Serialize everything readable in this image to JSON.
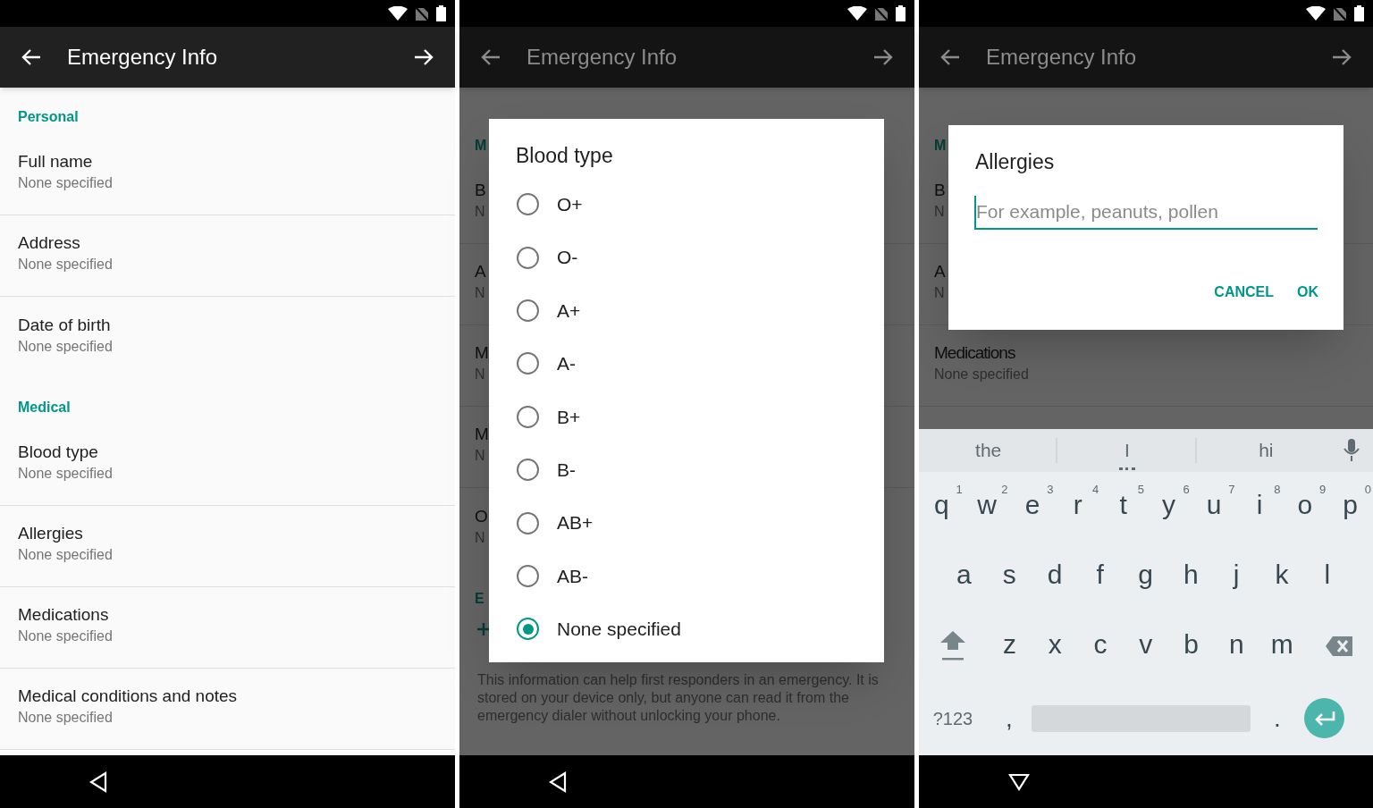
{
  "screens": [
    {
      "kind": "list",
      "dimmed": false,
      "toolbar": {
        "title": "Emergency Info"
      },
      "rows": [
        {
          "kind": "header",
          "text": "Personal"
        },
        {
          "kind": "item",
          "title": "Full name",
          "value": "None specified",
          "divider": true
        },
        {
          "kind": "item",
          "title": "Address",
          "value": "None specified",
          "divider": true
        },
        {
          "kind": "item",
          "title": "Date of birth",
          "value": "None specified",
          "divider": false
        },
        {
          "kind": "header",
          "text": "Medical"
        },
        {
          "kind": "item",
          "title": "Blood type",
          "value": "None specified",
          "divider": true
        },
        {
          "kind": "item",
          "title": "Allergies",
          "value": "None specified",
          "divider": true
        },
        {
          "kind": "item",
          "title": "Medications",
          "value": "None specified",
          "divider": true
        },
        {
          "kind": "item",
          "title": "Medical conditions and notes",
          "value": "None specified",
          "divider": true
        }
      ]
    },
    {
      "kind": "radio-dialog",
      "dimmed": true,
      "toolbar": {
        "title": "Emergency Info"
      },
      "rows": [
        {
          "kind": "header",
          "text": "M"
        },
        {
          "kind": "item",
          "title": "B",
          "value": "N",
          "divider": true
        },
        {
          "kind": "item",
          "title": "A",
          "value": "N",
          "divider": true
        },
        {
          "kind": "item",
          "title": "M",
          "value": "N",
          "divider": true
        },
        {
          "kind": "item",
          "title": "M",
          "value": "N",
          "divider": true
        },
        {
          "kind": "item",
          "title": "O",
          "value": "N",
          "divider": false
        },
        {
          "kind": "header",
          "text": "E"
        },
        {
          "kind": "add"
        }
      ],
      "footer": "This information can help first responders in an emergency. It is stored on your device only, but anyone can read it from the emergency dialer without unlocking your phone.",
      "dialog": {
        "title": "Blood type",
        "options": [
          {
            "label": "O+",
            "selected": false
          },
          {
            "label": "O-",
            "selected": false
          },
          {
            "label": "A+",
            "selected": false
          },
          {
            "label": "A-",
            "selected": false
          },
          {
            "label": "B+",
            "selected": false
          },
          {
            "label": "B-",
            "selected": false
          },
          {
            "label": "AB+",
            "selected": false
          },
          {
            "label": "AB-",
            "selected": false
          },
          {
            "label": "None specified",
            "selected": true
          }
        ]
      }
    },
    {
      "kind": "input-dialog",
      "dimmed": true,
      "toolbar": {
        "title": "Emergency Info"
      },
      "rows": [
        {
          "kind": "header",
          "text": "M"
        },
        {
          "kind": "item",
          "title": "B",
          "value": "N",
          "divider": true
        },
        {
          "kind": "item",
          "title": "A",
          "value": "N",
          "divider": true
        },
        {
          "kind": "item",
          "title": "Medications",
          "value": "None specified",
          "divider": true
        }
      ],
      "dialog": {
        "title": "Allergies",
        "placeholder": "For example, peanuts, pollen",
        "buttons": [
          "CANCEL",
          "OK"
        ]
      },
      "keyboard": {
        "suggestions": [
          "the",
          "I",
          "hi"
        ],
        "rows": [
          [
            {
              "key": "q",
              "hint": "1"
            },
            {
              "key": "w",
              "hint": "2"
            },
            {
              "key": "e",
              "hint": "3"
            },
            {
              "key": "r",
              "hint": "4"
            },
            {
              "key": "t",
              "hint": "5"
            },
            {
              "key": "y",
              "hint": "6"
            },
            {
              "key": "u",
              "hint": "7"
            },
            {
              "key": "i",
              "hint": "8"
            },
            {
              "key": "o",
              "hint": "9"
            },
            {
              "key": "p",
              "hint": "0"
            }
          ],
          [
            {
              "key": "a"
            },
            {
              "key": "s"
            },
            {
              "key": "d"
            },
            {
              "key": "f"
            },
            {
              "key": "g"
            },
            {
              "key": "h"
            },
            {
              "key": "j"
            },
            {
              "key": "k"
            },
            {
              "key": "l"
            }
          ],
          [
            {
              "key": "z"
            },
            {
              "key": "x"
            },
            {
              "key": "c"
            },
            {
              "key": "v"
            },
            {
              "key": "b"
            },
            {
              "key": "n"
            },
            {
              "key": "m"
            }
          ]
        ],
        "symbols": "?123",
        "comma": ",",
        "period": "."
      }
    }
  ]
}
